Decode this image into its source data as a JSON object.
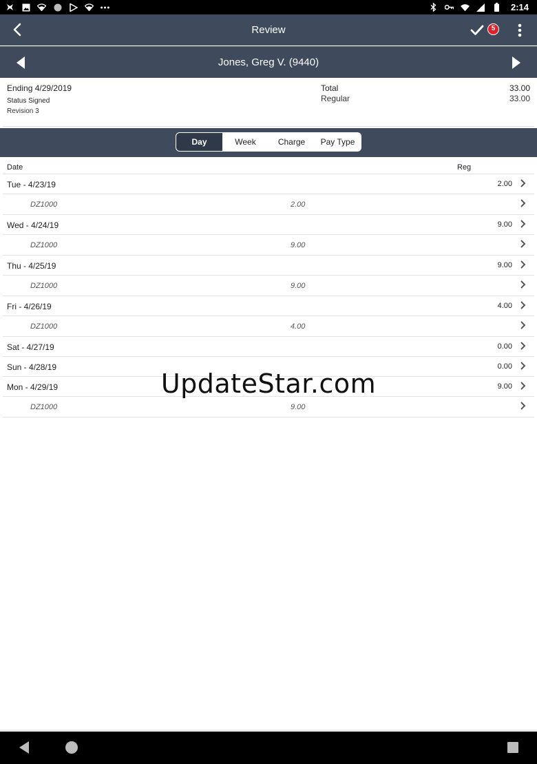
{
  "status_bar": {
    "time": "2:14",
    "left_icons": [
      "app-icon",
      "image-icon",
      "wifi-icon",
      "circle-icon",
      "play-store-icon",
      "wifi-icon",
      "more-dots-icon"
    ],
    "right_icons": [
      "bluetooth-icon",
      "key-icon",
      "wifi-icon",
      "signal-icon",
      "battery-icon"
    ]
  },
  "header": {
    "title": "Review",
    "badge_count": "5"
  },
  "employee": {
    "name": "Jones, Greg V. (9440)"
  },
  "summary": {
    "ending": "Ending 4/29/2019",
    "status": "Status Signed",
    "revision": "Revision 3",
    "total_label": "Total",
    "total_value": "33.00",
    "regular_label": "Regular",
    "regular_value": "33.00"
  },
  "tabs": [
    {
      "label": "Day",
      "active": true
    },
    {
      "label": "Week",
      "active": false
    },
    {
      "label": "Charge",
      "active": false
    },
    {
      "label": "Pay Type",
      "active": false
    }
  ],
  "table": {
    "col_date": "Date",
    "col_reg": "Reg",
    "days": [
      {
        "label": "Tue - 4/23/19",
        "reg": "2.00",
        "charges": [
          {
            "code": "DZ1000",
            "hours": "2.00"
          }
        ]
      },
      {
        "label": "Wed - 4/24/19",
        "reg": "9.00",
        "charges": [
          {
            "code": "DZ1000",
            "hours": "9.00"
          }
        ]
      },
      {
        "label": "Thu - 4/25/19",
        "reg": "9.00",
        "charges": [
          {
            "code": "DZ1000",
            "hours": "9.00"
          }
        ]
      },
      {
        "label": "Fri - 4/26/19",
        "reg": "4.00",
        "charges": [
          {
            "code": "DZ1000",
            "hours": "4.00"
          }
        ]
      },
      {
        "label": "Sat - 4/27/19",
        "reg": "0.00",
        "charges": []
      },
      {
        "label": "Sun - 4/28/19",
        "reg": "0.00",
        "charges": []
      },
      {
        "label": "Mon - 4/29/19",
        "reg": "9.00",
        "charges": [
          {
            "code": "DZ1000",
            "hours": "9.00"
          }
        ]
      }
    ]
  },
  "watermark": "UpdateStar.com",
  "colors": {
    "header_bg": "#3f4a5c",
    "active_tab_bg": "#2f394a",
    "badge": "#e0202a"
  }
}
